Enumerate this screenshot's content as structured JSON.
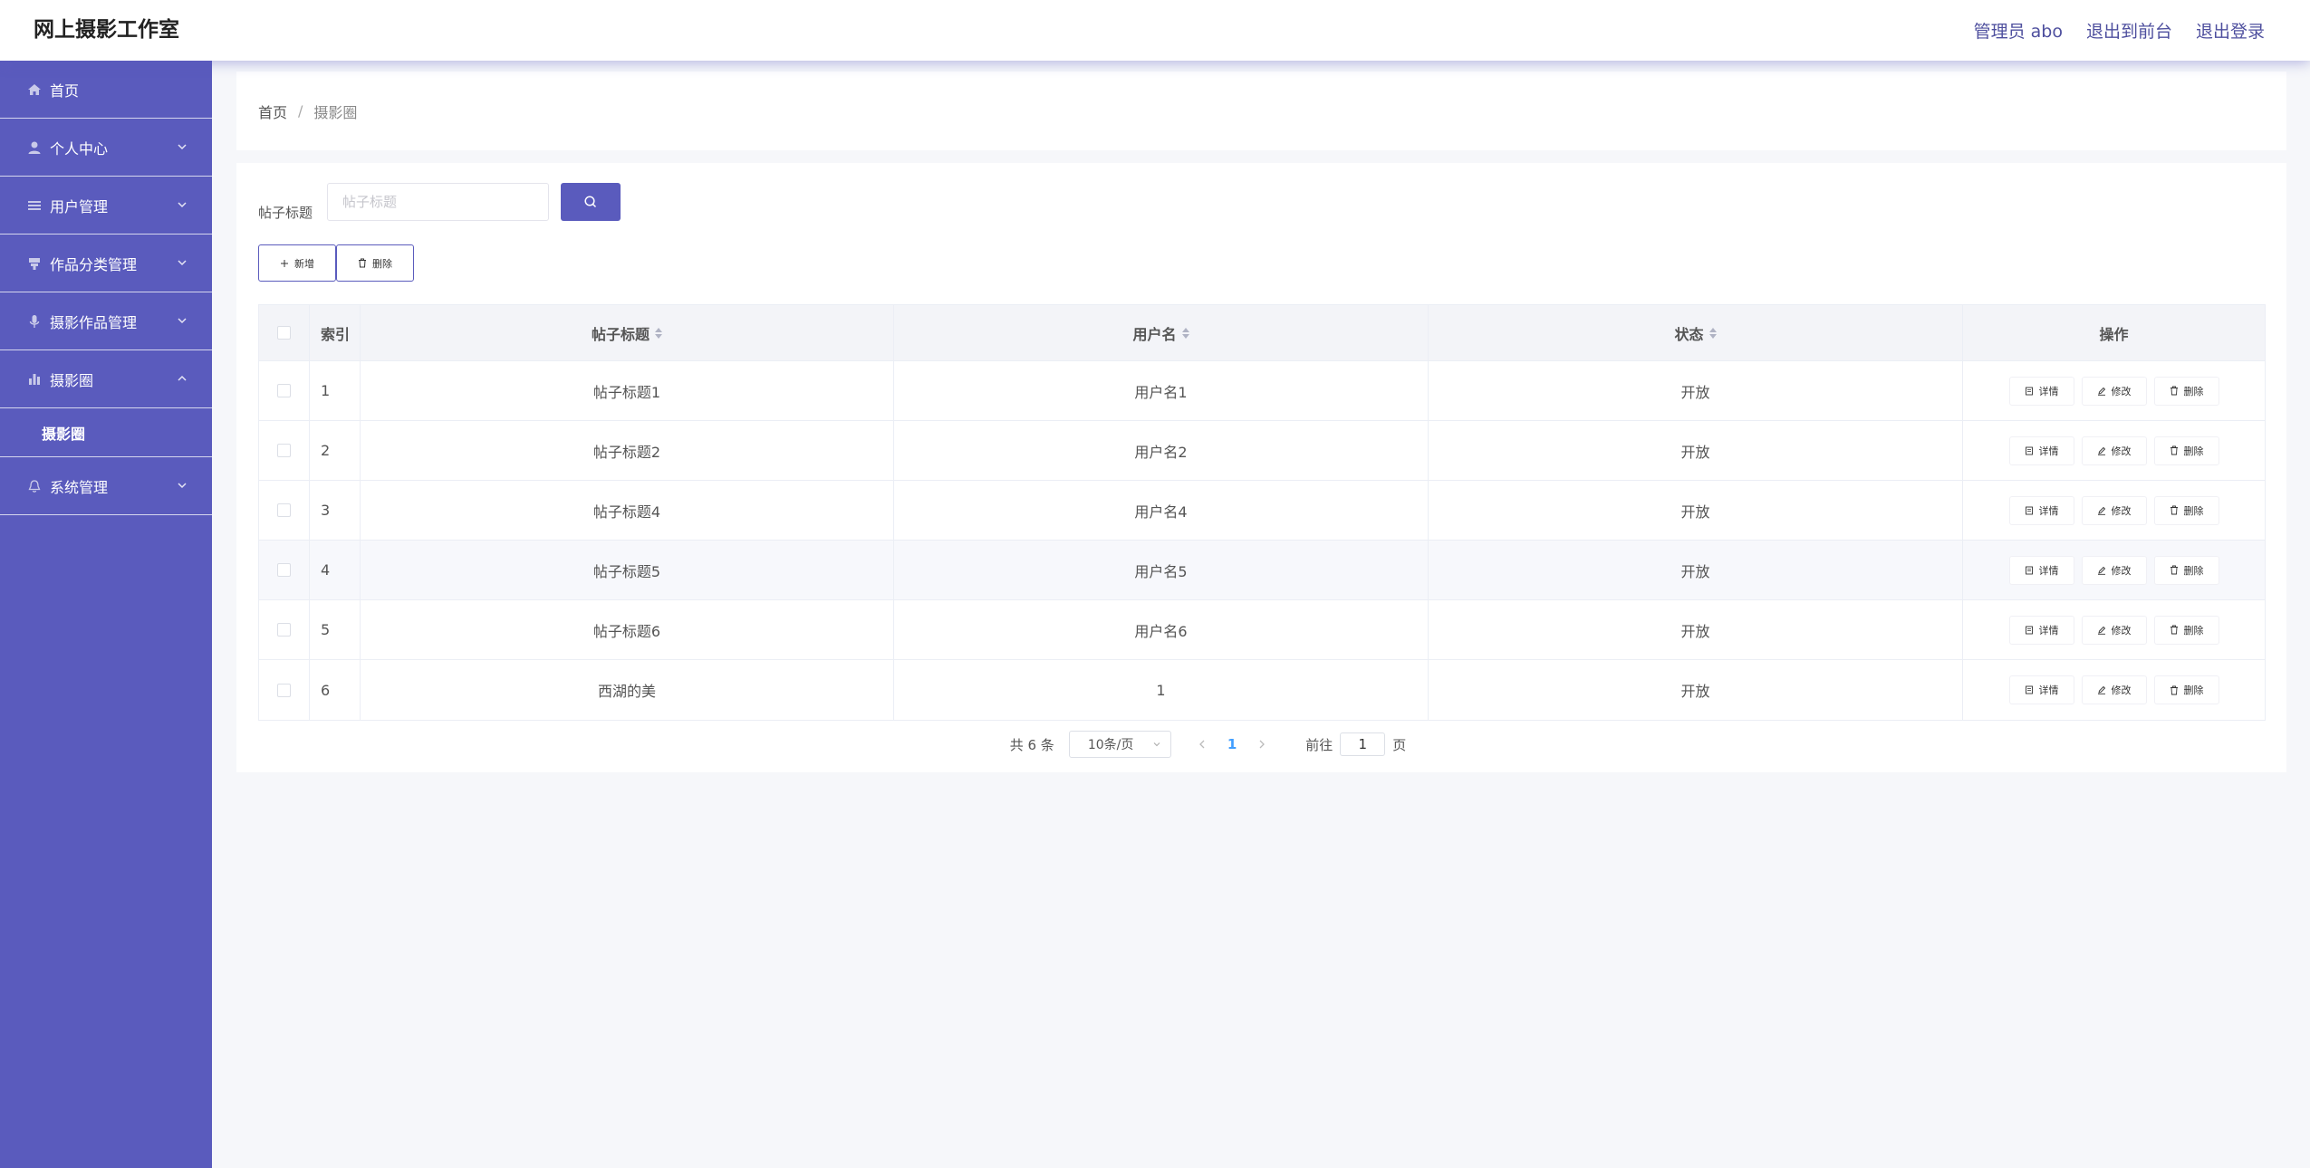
{
  "header": {
    "title": "网上摄影工作室",
    "admin": "管理员 abo",
    "to_front": "退出到前台",
    "logout": "退出登录"
  },
  "sidebar": {
    "items": [
      {
        "label": "首页",
        "icon": "home-icon"
      },
      {
        "label": "个人中心",
        "icon": "user-icon"
      },
      {
        "label": "用户管理",
        "icon": "list-icon"
      },
      {
        "label": "作品分类管理",
        "icon": "category-icon"
      },
      {
        "label": "摄影作品管理",
        "icon": "mic-icon"
      },
      {
        "label": "摄影圈",
        "icon": "bar-chart-icon",
        "expanded": true
      },
      {
        "label": "系统管理",
        "icon": "bell-icon"
      }
    ],
    "sub_active": "摄影圈"
  },
  "breadcrumb": {
    "home": "首页",
    "separator": "/",
    "current": "摄影圈"
  },
  "search": {
    "label": "帖子标题",
    "placeholder": "帖子标题",
    "value": ""
  },
  "toolbar": {
    "add_label": "新增",
    "delete_label": "删除"
  },
  "table": {
    "headers": {
      "index": "索引",
      "title": "帖子标题",
      "user": "用户名",
      "status": "状态",
      "ops": "操作"
    },
    "actions": {
      "detail": "详情",
      "edit": "修改",
      "delete": "删除"
    },
    "rows": [
      {
        "index": "1",
        "title": "帖子标题1",
        "user": "用户名1",
        "status": "开放"
      },
      {
        "index": "2",
        "title": "帖子标题2",
        "user": "用户名2",
        "status": "开放"
      },
      {
        "index": "3",
        "title": "帖子标题4",
        "user": "用户名4",
        "status": "开放"
      },
      {
        "index": "4",
        "title": "帖子标题5",
        "user": "用户名5",
        "status": "开放"
      },
      {
        "index": "5",
        "title": "帖子标题6",
        "user": "用户名6",
        "status": "开放"
      },
      {
        "index": "6",
        "title": "西湖的美",
        "user": "1",
        "status": "开放"
      }
    ]
  },
  "pagination": {
    "total": "共 6 条",
    "page_size": "10条/页",
    "current": "1",
    "goto_label": "前往",
    "goto_value": "1",
    "page_suffix": "页"
  },
  "colors": {
    "accent": "#5a5bbd",
    "link": "#4e4f9e",
    "page_active": "#409eff"
  }
}
